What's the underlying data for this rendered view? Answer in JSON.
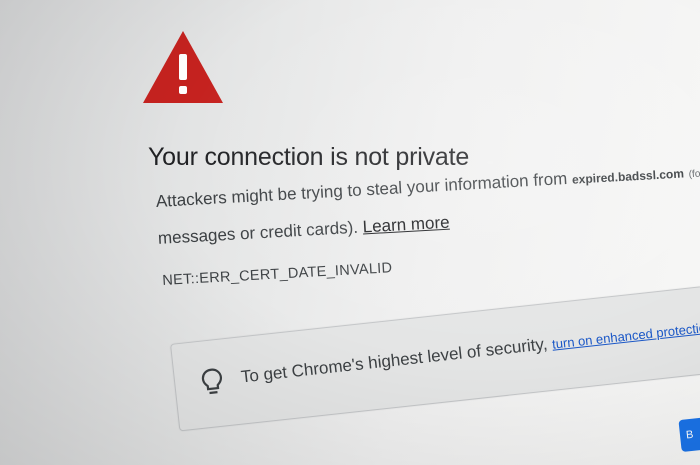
{
  "interstitial": {
    "title": "Your connection is not private",
    "description_prefix": "Attackers might be trying to steal your information from ",
    "hostname": "expired.badssl.com",
    "description_cut": "(for example, passwo",
    "description_line2": "messages or credit cards).",
    "learn_more": "Learn more",
    "error_code": "NET::ERR_CERT_DATE_INVALID"
  },
  "promo": {
    "text": "To get Chrome's highest level of security, ",
    "link": "turn on enhanced protection"
  },
  "icons": {
    "warning": "warning-triangle-icon",
    "bulb": "lightbulb-icon"
  },
  "corner_button": {
    "label": "B"
  },
  "colors": {
    "warning_red": "#c5221f",
    "link_blue": "#1a57c7",
    "button_blue": "#1a73e8"
  }
}
